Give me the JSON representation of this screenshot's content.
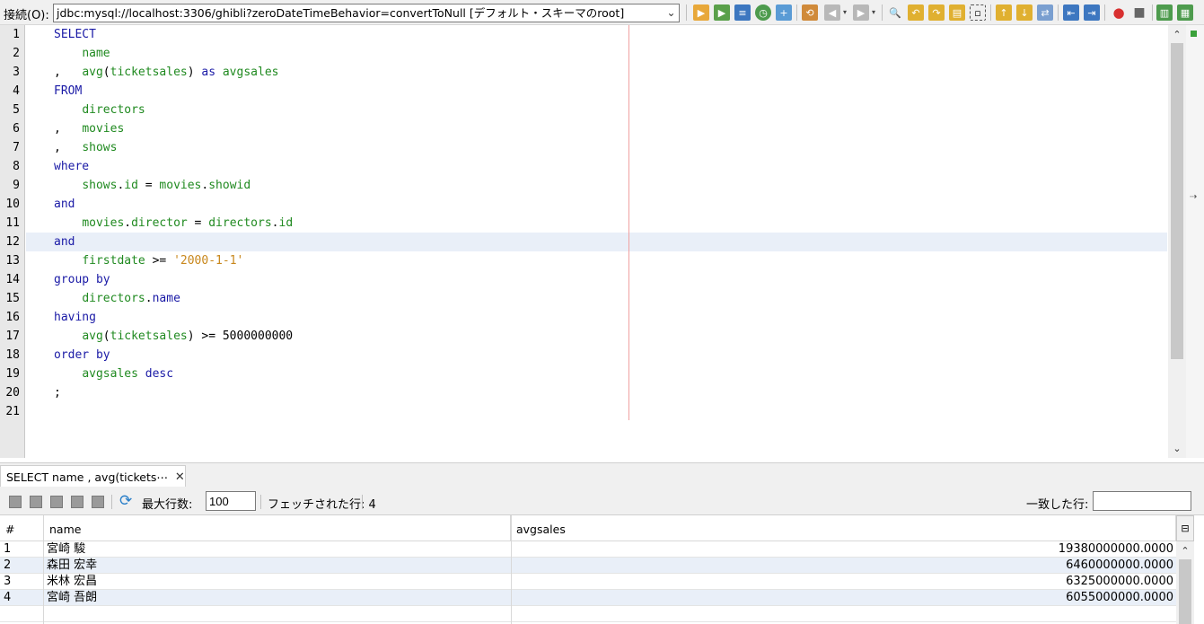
{
  "toolbar": {
    "connection_label": "接続(O):",
    "connection_value": "jdbc:mysql://localhost:3306/ghibli?zeroDateTimeBehavior=convertToNull [デフォルト・スキーマのroot]"
  },
  "editor": {
    "line_numbers": [
      "1",
      "2",
      "3",
      "4",
      "5",
      "6",
      "7",
      "8",
      "9",
      "10",
      "11",
      "12",
      "13",
      "14",
      "15",
      "16",
      "17",
      "18",
      "19",
      "20",
      "21"
    ],
    "highlighted_line": 12,
    "lines": [
      [
        {
          "t": "SELECT",
          "c": "kw"
        }
      ],
      [
        {
          "t": "    "
        },
        {
          "t": "name",
          "c": "id"
        }
      ],
      [
        {
          "t": ",   "
        },
        {
          "t": "avg",
          "c": "id"
        },
        {
          "t": "("
        },
        {
          "t": "ticketsales",
          "c": "id"
        },
        {
          "t": ") "
        },
        {
          "t": "as",
          "c": "kw"
        },
        {
          "t": " "
        },
        {
          "t": "avgsales",
          "c": "id"
        }
      ],
      [
        {
          "t": "FROM",
          "c": "kw"
        }
      ],
      [
        {
          "t": "    "
        },
        {
          "t": "directors",
          "c": "id"
        }
      ],
      [
        {
          "t": ",   "
        },
        {
          "t": "movies",
          "c": "id"
        }
      ],
      [
        {
          "t": ",   "
        },
        {
          "t": "shows",
          "c": "id"
        }
      ],
      [
        {
          "t": "where",
          "c": "kw"
        }
      ],
      [
        {
          "t": "    "
        },
        {
          "t": "shows",
          "c": "id"
        },
        {
          "t": "."
        },
        {
          "t": "id",
          "c": "id"
        },
        {
          "t": " = "
        },
        {
          "t": "movies",
          "c": "id"
        },
        {
          "t": "."
        },
        {
          "t": "showid",
          "c": "id"
        }
      ],
      [
        {
          "t": "and",
          "c": "kw"
        }
      ],
      [
        {
          "t": "    "
        },
        {
          "t": "movies",
          "c": "id"
        },
        {
          "t": "."
        },
        {
          "t": "director",
          "c": "id"
        },
        {
          "t": " = "
        },
        {
          "t": "directors",
          "c": "id"
        },
        {
          "t": "."
        },
        {
          "t": "id",
          "c": "id"
        }
      ],
      [
        {
          "t": "and",
          "c": "kw"
        }
      ],
      [
        {
          "t": "    "
        },
        {
          "t": "firstdate",
          "c": "id"
        },
        {
          "t": " >= "
        },
        {
          "t": "'2000-1-1'",
          "c": "str"
        }
      ],
      [
        {
          "t": "group by",
          "c": "kw"
        }
      ],
      [
        {
          "t": "    "
        },
        {
          "t": "directors",
          "c": "id"
        },
        {
          "t": "."
        },
        {
          "t": "name",
          "c": "kw"
        }
      ],
      [
        {
          "t": "having",
          "c": "kw"
        }
      ],
      [
        {
          "t": "    "
        },
        {
          "t": "avg",
          "c": "id"
        },
        {
          "t": "("
        },
        {
          "t": "ticketsales",
          "c": "id"
        },
        {
          "t": ") >= "
        },
        {
          "t": "5000000000"
        }
      ],
      [
        {
          "t": "order by",
          "c": "kw"
        }
      ],
      [
        {
          "t": "    "
        },
        {
          "t": "avgsales",
          "c": "id"
        },
        {
          "t": " "
        },
        {
          "t": "desc",
          "c": "kw"
        }
      ],
      [
        {
          "t": ";"
        }
      ],
      []
    ]
  },
  "colors": {
    "keyword": "#1a1aa6",
    "identifier": "#208a20",
    "string": "#c8871c",
    "plain": "#000000"
  },
  "results": {
    "tab_label": "SELECT name , avg(tickets⋯",
    "max_rows_label": "最大行数:",
    "max_rows_value": "100",
    "fetched_label": "フェッチされた行: 4",
    "match_label": "一致した行:",
    "match_value": "",
    "columns": [
      "#",
      "name",
      "avgsales"
    ],
    "rows": [
      {
        "num": "1",
        "name": "宮崎 駿",
        "avgsales": "19380000000.0000"
      },
      {
        "num": "2",
        "name": "森田 宏幸",
        "avgsales": "6460000000.0000"
      },
      {
        "num": "3",
        "name": "米林 宏昌",
        "avgsales": "6325000000.0000"
      },
      {
        "num": "4",
        "name": "宮崎 吾朗",
        "avgsales": "6055000000.0000"
      }
    ]
  }
}
